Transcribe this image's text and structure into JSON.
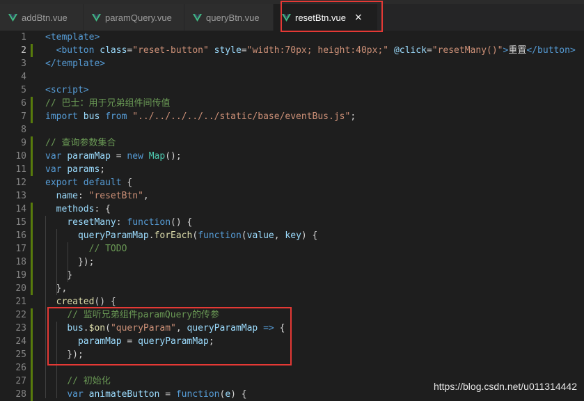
{
  "tabs": [
    {
      "label": "addBtn.vue",
      "active": false
    },
    {
      "label": "paramQuery.vue",
      "active": false
    },
    {
      "label": "queryBtn.vue",
      "active": false
    },
    {
      "label": "resetBtn.vue",
      "active": true,
      "close": "×"
    }
  ],
  "colors": {
    "editor_bg": "#1e1e1e",
    "tab_active_bg": "#1e1e1e",
    "tab_inactive_bg": "#2d2d2d",
    "vue_icon": "#41b883",
    "highlight_box": "#e53935",
    "git_modified": "#587c0c"
  },
  "icons": {
    "file": "vue-icon",
    "close": "close-icon"
  },
  "code_lines": [
    {
      "n": "1",
      "mod": false,
      "tokens": [
        [
          "t",
          "<template>"
        ]
      ]
    },
    {
      "n": "2",
      "mod": true,
      "current": true,
      "tokens": [
        [
          "p",
          "  "
        ],
        [
          "t",
          "<button"
        ],
        [
          "p",
          " "
        ],
        [
          "a",
          "class"
        ],
        [
          "p",
          "="
        ],
        [
          "s",
          "\"reset-button\""
        ],
        [
          "p",
          " "
        ],
        [
          "a",
          "style"
        ],
        [
          "p",
          "="
        ],
        [
          "s",
          "\"width:70px; height:40px;\""
        ],
        [
          "p",
          " "
        ],
        [
          "a",
          "@click"
        ],
        [
          "p",
          "="
        ],
        [
          "s",
          "\"resetMany()\""
        ],
        [
          "t",
          ">"
        ],
        [
          "p",
          "重置"
        ],
        [
          "t",
          "</button>"
        ]
      ]
    },
    {
      "n": "3",
      "mod": false,
      "tokens": [
        [
          "t",
          "</template>"
        ]
      ]
    },
    {
      "n": "4",
      "mod": false,
      "tokens": []
    },
    {
      "n": "5",
      "mod": false,
      "tokens": [
        [
          "t",
          "<script>"
        ]
      ]
    },
    {
      "n": "6",
      "mod": true,
      "tokens": [
        [
          "c",
          "// 巴士：用于兄弟组件间传值"
        ]
      ]
    },
    {
      "n": "7",
      "mod": true,
      "tokens": [
        [
          "k",
          "import"
        ],
        [
          "p",
          " "
        ],
        [
          "v",
          "bus"
        ],
        [
          "p",
          " "
        ],
        [
          "k",
          "from"
        ],
        [
          "p",
          " "
        ],
        [
          "s",
          "\"../../../../../static/base/eventBus.js\""
        ],
        [
          "p",
          ";"
        ]
      ]
    },
    {
      "n": "8",
      "mod": false,
      "tokens": []
    },
    {
      "n": "9",
      "mod": true,
      "tokens": [
        [
          "c",
          "// 查询参数集合"
        ]
      ]
    },
    {
      "n": "10",
      "mod": true,
      "tokens": [
        [
          "k",
          "var"
        ],
        [
          "p",
          " "
        ],
        [
          "v",
          "paramMap"
        ],
        [
          "p",
          " = "
        ],
        [
          "k",
          "new"
        ],
        [
          "p",
          " "
        ],
        [
          "cl",
          "Map"
        ],
        [
          "p",
          "();"
        ]
      ]
    },
    {
      "n": "11",
      "mod": true,
      "tokens": [
        [
          "k",
          "var"
        ],
        [
          "p",
          " "
        ],
        [
          "v",
          "params"
        ],
        [
          "p",
          ";"
        ]
      ]
    },
    {
      "n": "12",
      "mod": false,
      "tokens": [
        [
          "k",
          "export"
        ],
        [
          "p",
          " "
        ],
        [
          "k",
          "default"
        ],
        [
          "p",
          " {"
        ]
      ]
    },
    {
      "n": "13",
      "mod": false,
      "tokens": [
        [
          "p",
          "  "
        ],
        [
          "v",
          "name"
        ],
        [
          "p",
          ": "
        ],
        [
          "s",
          "\"resetBtn\""
        ],
        [
          "p",
          ","
        ]
      ]
    },
    {
      "n": "14",
      "mod": true,
      "tokens": [
        [
          "p",
          "  "
        ],
        [
          "v",
          "methods"
        ],
        [
          "p",
          ": {"
        ]
      ]
    },
    {
      "n": "15",
      "mod": true,
      "tokens": [
        [
          "p",
          "    "
        ],
        [
          "v",
          "resetMany"
        ],
        [
          "p",
          ": "
        ],
        [
          "k",
          "function"
        ],
        [
          "p",
          "() {"
        ]
      ]
    },
    {
      "n": "16",
      "mod": true,
      "tokens": [
        [
          "p",
          "      "
        ],
        [
          "v",
          "queryParamMap"
        ],
        [
          "p",
          "."
        ],
        [
          "f",
          "forEach"
        ],
        [
          "p",
          "("
        ],
        [
          "k",
          "function"
        ],
        [
          "p",
          "("
        ],
        [
          "v",
          "value"
        ],
        [
          "p",
          ", "
        ],
        [
          "v",
          "key"
        ],
        [
          "p",
          ") {"
        ]
      ]
    },
    {
      "n": "17",
      "mod": true,
      "tokens": [
        [
          "p",
          "        "
        ],
        [
          "c",
          "// TODO"
        ]
      ]
    },
    {
      "n": "18",
      "mod": true,
      "tokens": [
        [
          "p",
          "      });"
        ]
      ]
    },
    {
      "n": "19",
      "mod": true,
      "tokens": [
        [
          "p",
          "    }"
        ]
      ]
    },
    {
      "n": "20",
      "mod": true,
      "tokens": [
        [
          "p",
          "  },"
        ]
      ]
    },
    {
      "n": "21",
      "mod": false,
      "tokens": [
        [
          "p",
          "  "
        ],
        [
          "f",
          "created"
        ],
        [
          "p",
          "() {"
        ]
      ]
    },
    {
      "n": "22",
      "mod": true,
      "tokens": [
        [
          "p",
          "    "
        ],
        [
          "c",
          "// 监听兄弟组件paramQuery的传参"
        ]
      ]
    },
    {
      "n": "23",
      "mod": true,
      "tokens": [
        [
          "p",
          "    "
        ],
        [
          "v",
          "bus"
        ],
        [
          "p",
          "."
        ],
        [
          "f",
          "$on"
        ],
        [
          "p",
          "("
        ],
        [
          "s",
          "\"queryParam\""
        ],
        [
          "p",
          ", "
        ],
        [
          "v",
          "queryParamMap"
        ],
        [
          "p",
          " "
        ],
        [
          "k",
          "=>"
        ],
        [
          "p",
          " {"
        ]
      ]
    },
    {
      "n": "24",
      "mod": true,
      "tokens": [
        [
          "p",
          "      "
        ],
        [
          "v",
          "paramMap"
        ],
        [
          "p",
          " = "
        ],
        [
          "v",
          "queryParamMap"
        ],
        [
          "p",
          ";"
        ]
      ]
    },
    {
      "n": "25",
      "mod": true,
      "tokens": [
        [
          "p",
          "    });"
        ]
      ]
    },
    {
      "n": "26",
      "mod": true,
      "tokens": []
    },
    {
      "n": "27",
      "mod": true,
      "tokens": [
        [
          "p",
          "    "
        ],
        [
          "c",
          "// 初始化"
        ]
      ]
    },
    {
      "n": "28",
      "mod": true,
      "tokens": [
        [
          "p",
          "    "
        ],
        [
          "k",
          "var"
        ],
        [
          "p",
          " "
        ],
        [
          "v",
          "animateButton"
        ],
        [
          "p",
          " = "
        ],
        [
          "k",
          "function"
        ],
        [
          "p",
          "("
        ],
        [
          "v",
          "e"
        ],
        [
          "p",
          ") {"
        ]
      ]
    }
  ],
  "watermark": "https://blog.csdn.net/u011314442"
}
